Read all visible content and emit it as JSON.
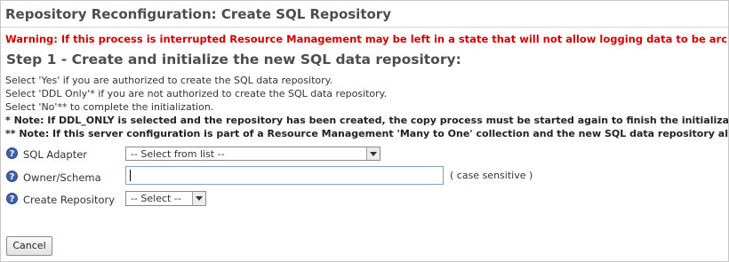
{
  "page": {
    "title": "Repository Reconfiguration: Create SQL Repository",
    "warning": "Warning: If this process is interrupted Resource Management may be left in a state that will not allow logging data to be archived.",
    "step_heading": "Step 1 - Create and initialize the new SQL data repository:"
  },
  "instructions": [
    "Select 'Yes' if you are authorized to create the SQL data repository.",
    "Select 'DDL Only'* if you are not authorized to create the SQL data repository.",
    "Select 'No'** to complete the initialization."
  ],
  "notes": [
    "* Note: If DDL_ONLY is selected and the repository has been created, the copy process must be started again to finish the initialization.",
    "** Note: If this server configuration is part of a Resource Management 'Many to One' collection and the new SQL data repository already exists, select 'No'."
  ],
  "form": {
    "help_glyph": "?",
    "sql_adapter": {
      "label": "SQL Adapter",
      "value": "-- Select from list --"
    },
    "owner_schema": {
      "label": "Owner/Schema",
      "value": "",
      "hint": "( case sensitive )"
    },
    "create_repository": {
      "label": "Create Repository",
      "value": "-- Select --"
    }
  },
  "buttons": {
    "cancel": "Cancel"
  },
  "colors": {
    "warning": "#d40000",
    "help_icon": "#3d61a8",
    "input_border": "#7ea0cc"
  },
  "icons": {
    "help": "help-question-icon",
    "dropdown": "chevron-down-icon"
  }
}
